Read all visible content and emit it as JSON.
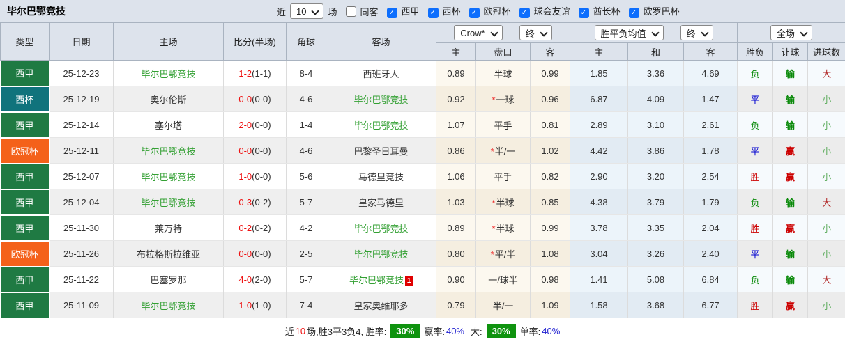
{
  "colors": {
    "header_bg": "#dde3ec",
    "laliga_badge": "#1f7a43",
    "copa_badge": "#10737c",
    "ucl_badge": "#f4611a",
    "team_highlight": "#33a033",
    "score_red": "#ee1111",
    "win_red": "#cc0000",
    "draw_blue": "#0000d0",
    "lose_green": "#0a8a0a",
    "big_red": "#b22a2a",
    "small_green": "#62ae62",
    "checkbox_blue": "#0d6efd",
    "badge_green": "#0f930f",
    "percent_blue": "#2020d0"
  },
  "header": {
    "team_title": "毕尔巴鄂竞技",
    "near_label": "近",
    "matches_value": "10",
    "matches_label": "场",
    "same_venue_label": "同客",
    "check_glyph": "✓",
    "leagues": [
      {
        "label": "西甲",
        "checked": true
      },
      {
        "label": "西杯",
        "checked": true
      },
      {
        "label": "欧冠杯",
        "checked": true
      },
      {
        "label": "球会友谊",
        "checked": true
      },
      {
        "label": "酋长杯",
        "checked": true
      },
      {
        "label": "欧罗巴杯",
        "checked": true
      }
    ]
  },
  "table": {
    "star_glyph": "*",
    "left_headers": [
      "类型",
      "日期",
      "主场",
      "比分(半场)",
      "角球",
      "客场"
    ],
    "sub_headers": [
      "主",
      "盘口",
      "客",
      "主",
      "和",
      "客",
      "胜负",
      "让球",
      "进球数"
    ],
    "selects": {
      "bookmaker": "Crow*",
      "odds_time": "终",
      "avg_name": "胜平负均值",
      "avg_time": "终",
      "scope": "全场"
    },
    "rows": [
      {
        "type": "西甲",
        "date": "25-12-23",
        "home": "毕尔巴鄂竞技",
        "home_hl": true,
        "score": "1-2",
        "half": "(1-1)",
        "corner": "8-4",
        "away": "西班牙人",
        "away_hl": false,
        "away_card": "",
        "star": false,
        "crow": [
          "0.89",
          "半球",
          "0.99"
        ],
        "avg": [
          "1.85",
          "3.36",
          "4.69"
        ],
        "results": [
          "负",
          "输",
          "大"
        ]
      },
      {
        "type": "西杯",
        "date": "25-12-19",
        "home": "奥尔伦斯",
        "home_hl": false,
        "score": "0-0",
        "half": "(0-0)",
        "corner": "4-6",
        "away": "毕尔巴鄂竞技",
        "away_hl": true,
        "away_card": "",
        "star": true,
        "crow": [
          "0.92",
          "一球",
          "0.96"
        ],
        "avg": [
          "6.87",
          "4.09",
          "1.47"
        ],
        "results": [
          "平",
          "输",
          "小"
        ]
      },
      {
        "type": "西甲",
        "date": "25-12-14",
        "home": "塞尔塔",
        "home_hl": false,
        "score": "2-0",
        "half": "(0-0)",
        "corner": "1-4",
        "away": "毕尔巴鄂竞技",
        "away_hl": true,
        "away_card": "",
        "star": false,
        "crow": [
          "1.07",
          "平手",
          "0.81"
        ],
        "avg": [
          "2.89",
          "3.10",
          "2.61"
        ],
        "results": [
          "负",
          "输",
          "小"
        ]
      },
      {
        "type": "欧冠杯",
        "date": "25-12-11",
        "home": "毕尔巴鄂竞技",
        "home_hl": true,
        "score": "0-0",
        "half": "(0-0)",
        "corner": "4-6",
        "away": "巴黎圣日耳曼",
        "away_hl": false,
        "away_card": "",
        "star": true,
        "crow": [
          "0.86",
          "半/一",
          "1.02"
        ],
        "avg": [
          "4.42",
          "3.86",
          "1.78"
        ],
        "results": [
          "平",
          "赢",
          "小"
        ]
      },
      {
        "type": "西甲",
        "date": "25-12-07",
        "home": "毕尔巴鄂竞技",
        "home_hl": true,
        "score": "1-0",
        "half": "(0-0)",
        "corner": "5-6",
        "away": "马德里竞技",
        "away_hl": false,
        "away_card": "",
        "star": false,
        "crow": [
          "1.06",
          "平手",
          "0.82"
        ],
        "avg": [
          "2.90",
          "3.20",
          "2.54"
        ],
        "results": [
          "胜",
          "赢",
          "小"
        ]
      },
      {
        "type": "西甲",
        "date": "25-12-04",
        "home": "毕尔巴鄂竞技",
        "home_hl": true,
        "score": "0-3",
        "half": "(0-2)",
        "corner": "5-7",
        "away": "皇家马德里",
        "away_hl": false,
        "away_card": "",
        "star": true,
        "crow": [
          "1.03",
          "半球",
          "0.85"
        ],
        "avg": [
          "4.38",
          "3.79",
          "1.79"
        ],
        "results": [
          "负",
          "输",
          "大"
        ]
      },
      {
        "type": "西甲",
        "date": "25-11-30",
        "home": "莱万特",
        "home_hl": false,
        "score": "0-2",
        "half": "(0-2)",
        "corner": "4-2",
        "away": "毕尔巴鄂竞技",
        "away_hl": true,
        "away_card": "",
        "star": true,
        "crow": [
          "0.89",
          "半球",
          "0.99"
        ],
        "avg": [
          "3.78",
          "3.35",
          "2.04"
        ],
        "results": [
          "胜",
          "赢",
          "小"
        ]
      },
      {
        "type": "欧冠杯",
        "date": "25-11-26",
        "home": "布拉格斯拉维亚",
        "home_hl": false,
        "score": "0-0",
        "half": "(0-0)",
        "corner": "2-5",
        "away": "毕尔巴鄂竞技",
        "away_hl": true,
        "away_card": "",
        "star": true,
        "crow": [
          "0.80",
          "平/半",
          "1.08"
        ],
        "avg": [
          "3.04",
          "3.26",
          "2.40"
        ],
        "results": [
          "平",
          "输",
          "小"
        ]
      },
      {
        "type": "西甲",
        "date": "25-11-22",
        "home": "巴塞罗那",
        "home_hl": false,
        "score": "4-0",
        "half": "(2-0)",
        "corner": "5-7",
        "away": "毕尔巴鄂竞技",
        "away_hl": true,
        "away_card": "1",
        "star": false,
        "crow": [
          "0.90",
          "一/球半",
          "0.98"
        ],
        "avg": [
          "1.41",
          "5.08",
          "6.84"
        ],
        "results": [
          "负",
          "输",
          "大"
        ]
      },
      {
        "type": "西甲",
        "date": "25-11-09",
        "home": "毕尔巴鄂竞技",
        "home_hl": true,
        "score": "1-0",
        "half": "(1-0)",
        "corner": "7-4",
        "away": "皇家奥维耶多",
        "away_hl": false,
        "away_card": "",
        "star": false,
        "crow": [
          "0.79",
          "半/一",
          "1.09"
        ],
        "avg": [
          "1.58",
          "3.68",
          "6.77"
        ],
        "results": [
          "胜",
          "赢",
          "小"
        ]
      }
    ]
  },
  "footer": {
    "p1": "近",
    "count": "10",
    "p2": "场,胜3平3负4, 胜率:",
    "rate1": "30%",
    "p3": "赢率:",
    "rate2": "40%",
    "p4": "大:",
    "rate3": "30%",
    "p5": "单率:",
    "rate4": "40%"
  }
}
